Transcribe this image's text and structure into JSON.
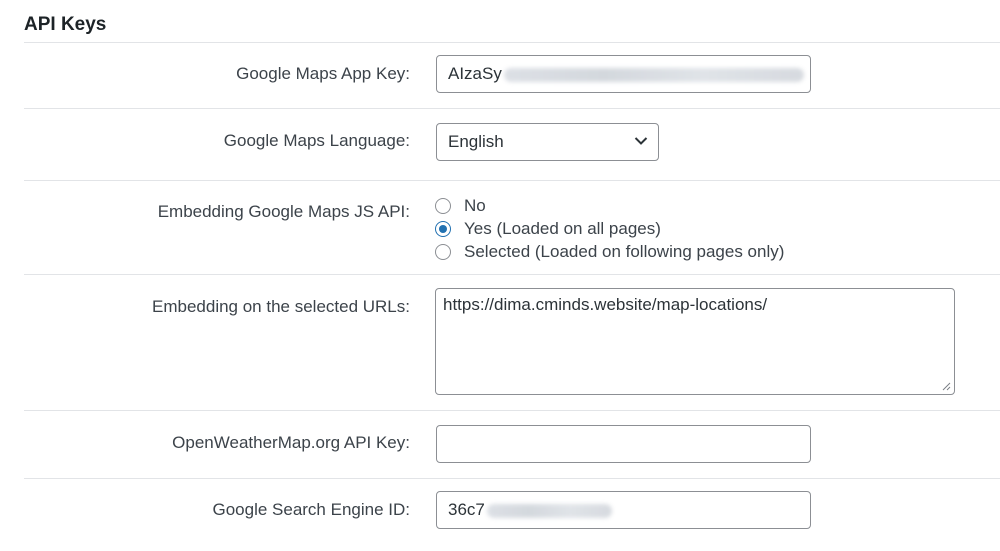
{
  "section": {
    "title": "API Keys"
  },
  "fields": {
    "maps_app_key": {
      "label": "Google Maps App Key:",
      "visible_value": "AIzaSy",
      "obscured": true
    },
    "maps_language": {
      "label": "Google Maps Language:",
      "selected": "English",
      "icon": "chevron-down-icon"
    },
    "embedding_js_api": {
      "label": "Embedding Google Maps JS API:",
      "options": [
        {
          "label": "No",
          "checked": false
        },
        {
          "label": "Yes (Loaded on all pages)",
          "checked": true
        },
        {
          "label": "Selected (Loaded on following pages only)",
          "checked": false
        }
      ]
    },
    "selected_urls": {
      "label": "Embedding on the selected URLs:",
      "value": "https://dima.cminds.website/map-locations/"
    },
    "openweathermap_key": {
      "label": "OpenWeatherMap.org API Key:",
      "value": ""
    },
    "search_engine_id": {
      "label": "Google Search Engine ID:",
      "visible_value": "36c7",
      "obscured": true
    }
  },
  "colors": {
    "accent": "#2271b1",
    "border": "#8c8f94",
    "divider": "#e2e4e7"
  }
}
